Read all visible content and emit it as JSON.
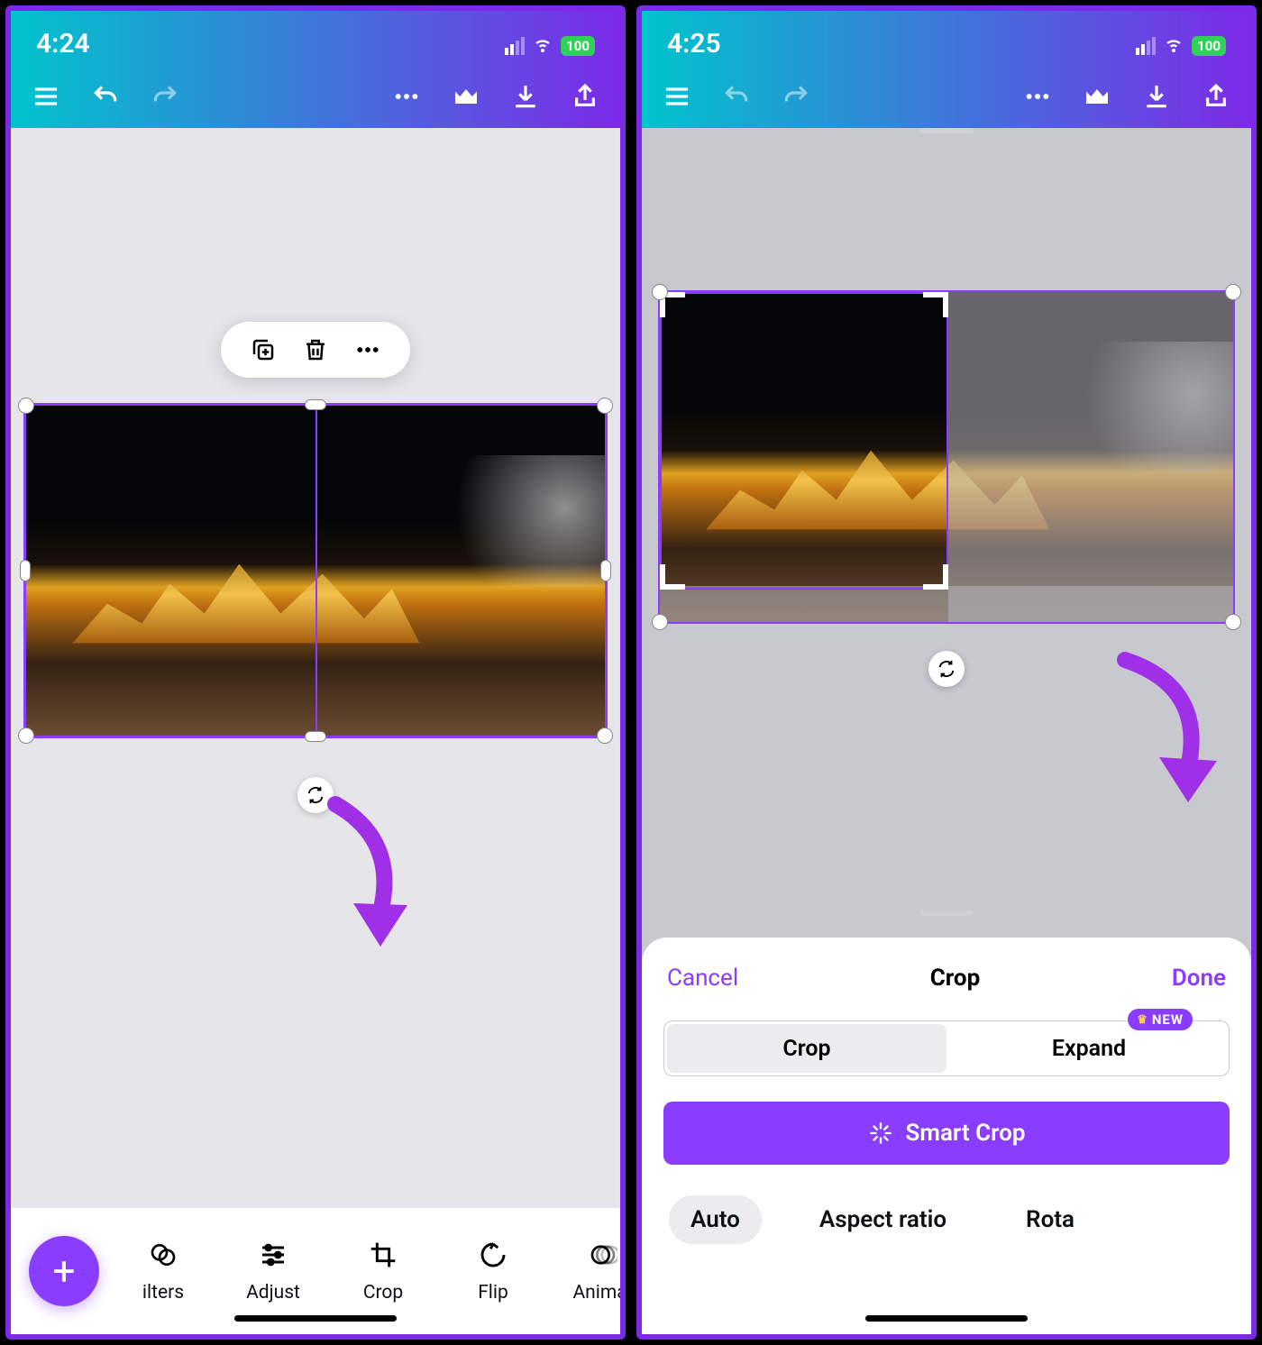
{
  "left": {
    "status": {
      "time": "4:24",
      "battery": "100"
    },
    "toolbar": {
      "items": [
        {
          "name": "ilters"
        },
        {
          "name": "Adjust"
        },
        {
          "name": "Crop"
        },
        {
          "name": "Flip"
        },
        {
          "name": "Animat"
        }
      ]
    },
    "selection_toolbar": {
      "duplicate": "duplicate",
      "delete": "delete",
      "more": "more"
    }
  },
  "right": {
    "status": {
      "time": "4:25",
      "battery": "100"
    },
    "sheet": {
      "cancel": "Cancel",
      "title": "Crop",
      "done": "Done",
      "seg_crop": "Crop",
      "seg_expand": "Expand",
      "new_badge": "NEW",
      "smart_crop": "Smart Crop",
      "chips": {
        "auto": "Auto",
        "aspect": "Aspect ratio",
        "rotate": "Rota"
      }
    }
  },
  "colors": {
    "accent": "#8b3dff",
    "gradient_start": "#00c4cc",
    "gradient_end": "#7d2ae8"
  }
}
